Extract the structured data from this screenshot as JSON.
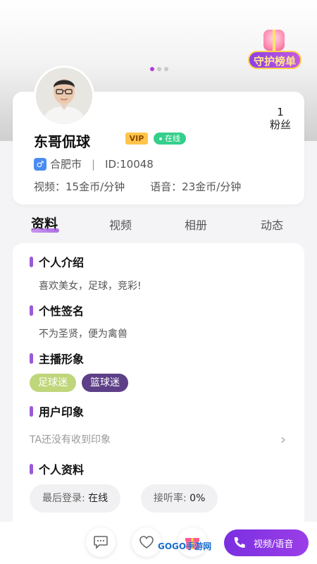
{
  "pager": {
    "count": 3,
    "active": 0
  },
  "guard_badge": {
    "label": "守护榜单"
  },
  "profile": {
    "name": "东哥侃球",
    "vip": "VIP",
    "status": "在线",
    "gender_icon": "male-icon",
    "city": "合肥市",
    "separator": "|",
    "id": "ID:10048",
    "video_price": "视频：15金币/分钟",
    "voice_price": "语音：23金币/分钟",
    "fans_count": "1",
    "fans_label": "粉丝"
  },
  "tabs": [
    {
      "label": "资料",
      "active": true
    },
    {
      "label": "视频",
      "active": false
    },
    {
      "label": "相册",
      "active": false
    },
    {
      "label": "动态",
      "active": false
    }
  ],
  "info": {
    "intro_title": "个人介绍",
    "intro_text": "喜欢美女，足球，竞彩!",
    "signature_title": "个性签名",
    "signature_text": "不为圣贤，便为禽兽",
    "image_title": "主播形象",
    "image_tags": [
      "足球迷",
      "篮球迷"
    ],
    "impression_title": "用户印象",
    "impression_text": "TA还没有收到印象",
    "details_title": "个人资料",
    "last_login_label": "最后登录:",
    "last_login_value": "在线",
    "answer_rate_label": "接听率:",
    "answer_rate_value": "0%"
  },
  "bottom_bar": {
    "call_label": "视频/语音",
    "icons": [
      "message-icon",
      "heart-icon",
      "gift-icon",
      "phone-icon"
    ]
  },
  "watermark": "GOGO手游网",
  "colors": {
    "accent": "#9b59d8",
    "online": "#34cf8b",
    "vip": "#ffc44a",
    "tag_green": "#bfd67a",
    "tag_purple": "#5d3f88",
    "call_button": "#7a2fe0"
  }
}
